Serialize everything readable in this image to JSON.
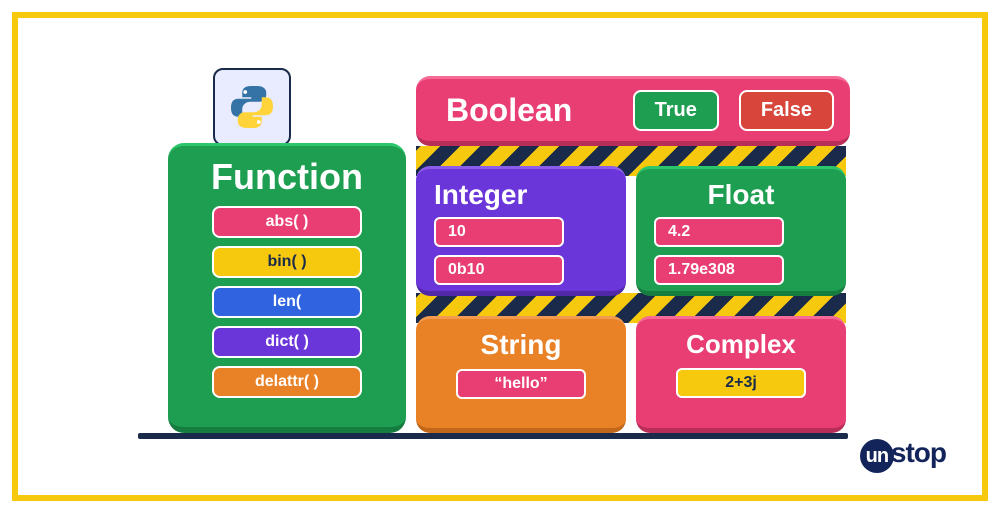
{
  "function": {
    "title": "Function",
    "items": [
      "abs( )",
      "bin( )",
      "len(",
      "dict( )",
      "delattr( )"
    ]
  },
  "boolean": {
    "title": "Boolean",
    "true_label": "True",
    "false_label": "False"
  },
  "integer": {
    "title": "Integer",
    "values": [
      "10",
      "0b10"
    ]
  },
  "float": {
    "title": "Float",
    "values": [
      "4.2",
      "1.79e308"
    ]
  },
  "string": {
    "title": "String",
    "values": [
      "“hello”"
    ]
  },
  "complex": {
    "title": "Complex",
    "values": [
      "2+3j"
    ]
  },
  "brand": "stop"
}
